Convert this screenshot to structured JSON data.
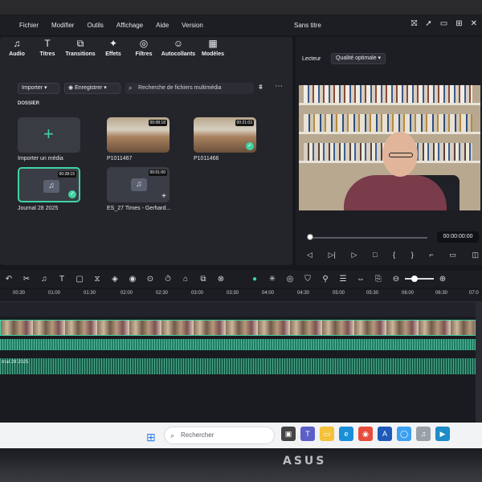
{
  "menu": {
    "items": [
      "Fichier",
      "Modifier",
      "Outils",
      "Affichage",
      "Aide",
      "Version"
    ],
    "window_title": "Sans titre"
  },
  "toolbar": {
    "tools": [
      {
        "label": "Audio",
        "icon": "music-icon"
      },
      {
        "label": "Titres",
        "icon": "text-icon"
      },
      {
        "label": "Transitions",
        "icon": "transitions-icon"
      },
      {
        "label": "Effets",
        "icon": "effects-icon"
      },
      {
        "label": "Filtres",
        "icon": "filters-icon"
      },
      {
        "label": "Autocollants",
        "icon": "sticker-icon"
      },
      {
        "label": "Modèles",
        "icon": "templates-icon"
      }
    ]
  },
  "library": {
    "import_label": "Importer",
    "record_label": "Enregistrer",
    "search_placeholder": "Recherche de fichiers multimédia",
    "folder_label": "DOSSIER",
    "import_media_label": "Importer un média",
    "clips": [
      {
        "name": "P1011467",
        "duration": "00:08:18"
      },
      {
        "name": "P1011466",
        "duration": "00:21:03"
      },
      {
        "name": "Journal 28 2025",
        "duration": "00:28:15"
      },
      {
        "name": "ES_27 Times - Gerhard...",
        "duration": "00:01:00"
      }
    ]
  },
  "player": {
    "tab": "Lecteur",
    "quality": "Qualité optimale",
    "timecode": "00:00:00:00"
  },
  "timeline": {
    "ticks": [
      "00:30",
      "01:00",
      "01:30",
      "02:00",
      "02:30",
      "03:00",
      "03:30",
      "04:00",
      "04:30",
      "05:00",
      "05:30",
      "06:00",
      "06:30",
      "07:0"
    ],
    "audio_clip_label": "rnal 28 2025"
  },
  "taskbar": {
    "search_label": "Rechercher"
  },
  "device": {
    "brand": "ASUS"
  },
  "colors": {
    "accent": "#3fd3a2",
    "panel": "#24252b",
    "background": "#17181c"
  }
}
